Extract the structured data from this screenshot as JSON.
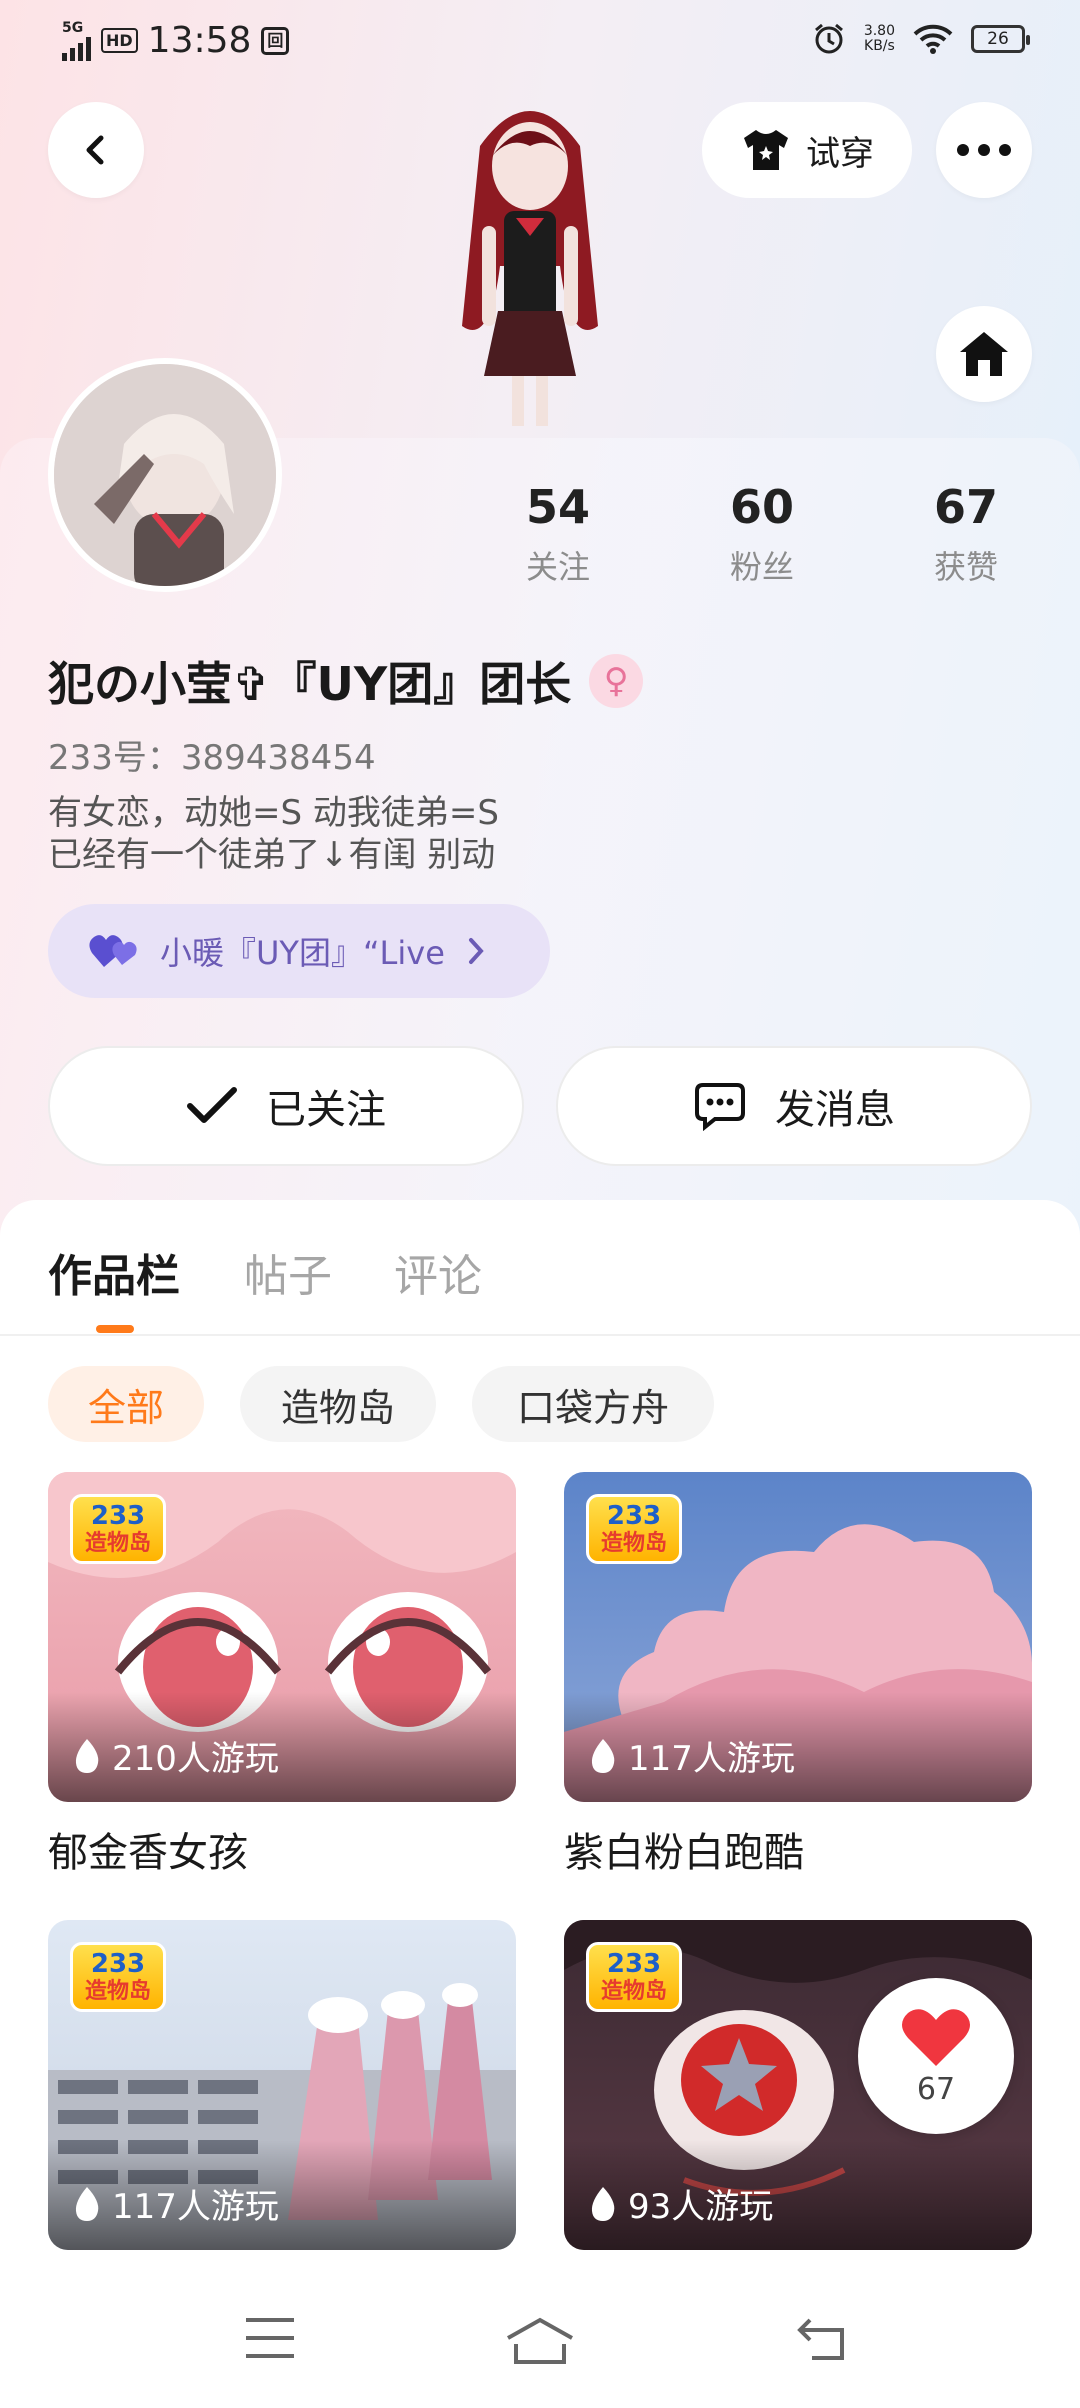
{
  "status_bar": {
    "network": "5G",
    "hd": "HD",
    "time": "13:58",
    "extra_icon": "回",
    "speed_value": "3.80",
    "speed_unit": "KB/s",
    "battery": "26"
  },
  "header": {
    "try_on_label": "试穿",
    "back_icon": "chevron-left-icon",
    "more_icon": "more-dots-icon",
    "home_icon": "home-icon"
  },
  "profile": {
    "stats": [
      {
        "value": "54",
        "label": "关注"
      },
      {
        "value": "60",
        "label": "粉丝"
      },
      {
        "value": "67",
        "label": "获赞"
      }
    ],
    "username": "犯の小莹✞『UY团』团长",
    "uid": "233号：389438454",
    "bio_line1": "有女恋，动她=S 动我徒弟=S",
    "bio_line2": "已经有一个徒弟了↓有闺 别动",
    "fan_badge": "小暖『UY团』“Live"
  },
  "actions": {
    "follow_label": "已关注",
    "message_label": "发消息"
  },
  "tabs": [
    {
      "label": "作品栏",
      "active": true
    },
    {
      "label": "帖子",
      "active": false
    },
    {
      "label": "评论",
      "active": false
    }
  ],
  "filters": [
    {
      "label": "全部",
      "active": true
    },
    {
      "label": "造物岛",
      "active": false
    },
    {
      "label": "口袋方舟",
      "active": false
    }
  ],
  "works": [
    {
      "title": "郁金香女孩",
      "plays": "210人游玩",
      "badge_top": "233",
      "badge_bottom": "造物岛"
    },
    {
      "title": "紫白粉白跑酷",
      "plays": "117人游玩",
      "badge_top": "233",
      "badge_bottom": "造物岛"
    },
    {
      "title": "",
      "plays": "117人游玩",
      "badge_top": "233",
      "badge_bottom": "造物岛"
    },
    {
      "title": "",
      "plays": "93人游玩",
      "badge_top": "233",
      "badge_bottom": "造物岛"
    }
  ],
  "like_bubble": {
    "count": "67"
  },
  "colors": {
    "accent_orange": "#ff7a1a",
    "badge_purple": "#6b5bb5",
    "gender_pink": "#e8739a"
  }
}
